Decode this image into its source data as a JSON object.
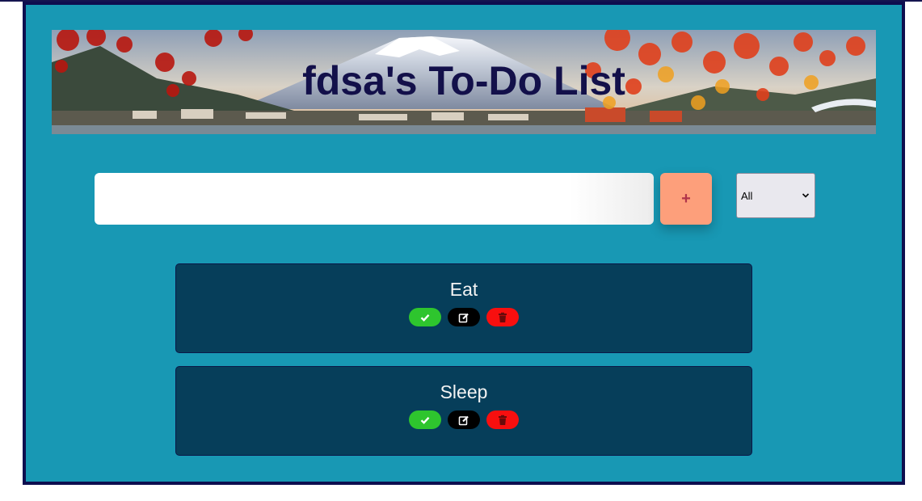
{
  "header": {
    "title": "fdsa's To-Do List"
  },
  "form": {
    "input_value": "",
    "input_placeholder": "",
    "add_button_label": "+",
    "filter_selected": "All"
  },
  "todos": [
    {
      "text": "Eat",
      "complete_icon": "check-icon",
      "edit_icon": "edit-icon",
      "delete_icon": "trash-icon"
    },
    {
      "text": "Sleep",
      "complete_icon": "check-icon",
      "edit_icon": "edit-icon",
      "delete_icon": "trash-icon"
    }
  ],
  "colors": {
    "frame_background": "#1898b4",
    "frame_border": "#0e0e4f",
    "title_color": "#13104a",
    "add_button": "#fd9f7b",
    "todo_background": "#063e5a",
    "complete_button": "#2ec52e",
    "edit_button": "#000000",
    "delete_button": "#f80f0f"
  }
}
